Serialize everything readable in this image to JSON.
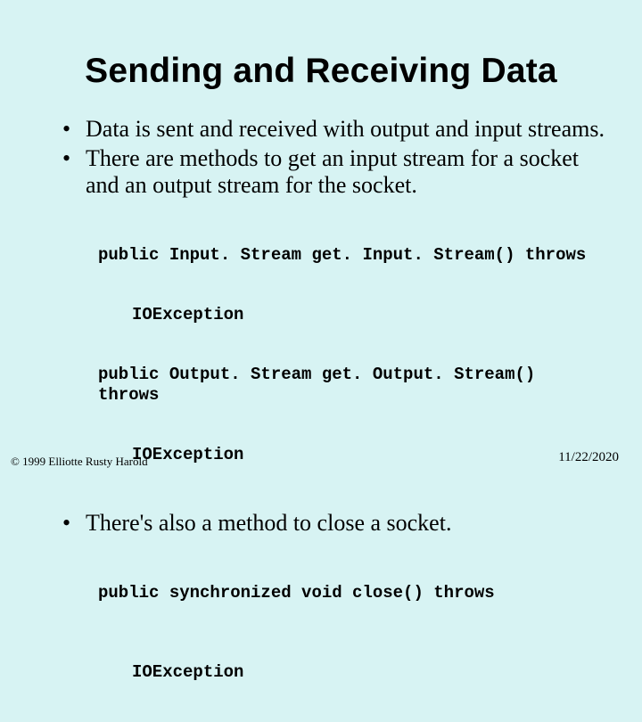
{
  "title": "Sending and Receiving Data",
  "bullets": {
    "b1": "Data is sent and received with output and input streams.",
    "b2": "There are methods to get an input stream for a socket and an output stream for the socket.",
    "b3": "There's also a method to close a socket."
  },
  "code1": {
    "l1": "public Input. Stream get. Input. Stream() throws",
    "l1c": "IOException",
    "l2": "public Output. Stream get. Output. Stream() throws",
    "l2c": "IOException"
  },
  "code2": {
    "l1": "public synchronized void close() throws",
    "l1c": "IOException"
  },
  "footer": {
    "left": "© 1999 Elliotte Rusty Harold",
    "right": "11/22/2020"
  }
}
